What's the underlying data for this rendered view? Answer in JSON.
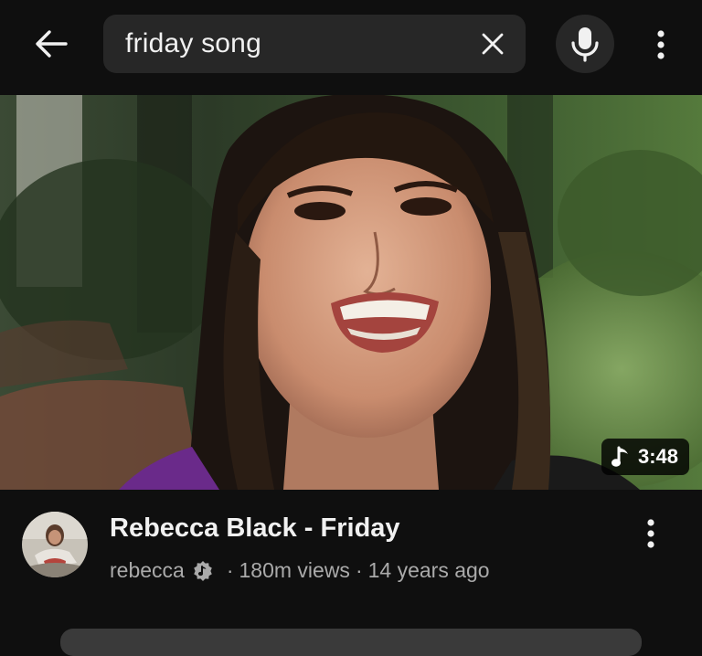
{
  "search": {
    "query": "friday song",
    "back_icon": "arrow-left-icon",
    "clear_icon": "close-icon",
    "mic_icon": "microphone-icon",
    "more_icon": "more-vertical-icon"
  },
  "video": {
    "duration": "3:48",
    "duration_icon": "music-note-icon",
    "title": "Rebecca Black - Friday",
    "channel": "rebecca",
    "verified_icon": "verified-artist-icon",
    "separator": "·",
    "views": "180m views",
    "age": "14 years ago",
    "more_icon": "more-vertical-icon"
  },
  "colors": {
    "background": "#0f0f0f",
    "surface": "#272727",
    "text_primary": "#f1f1f1",
    "text_secondary": "#aaaaaa"
  }
}
